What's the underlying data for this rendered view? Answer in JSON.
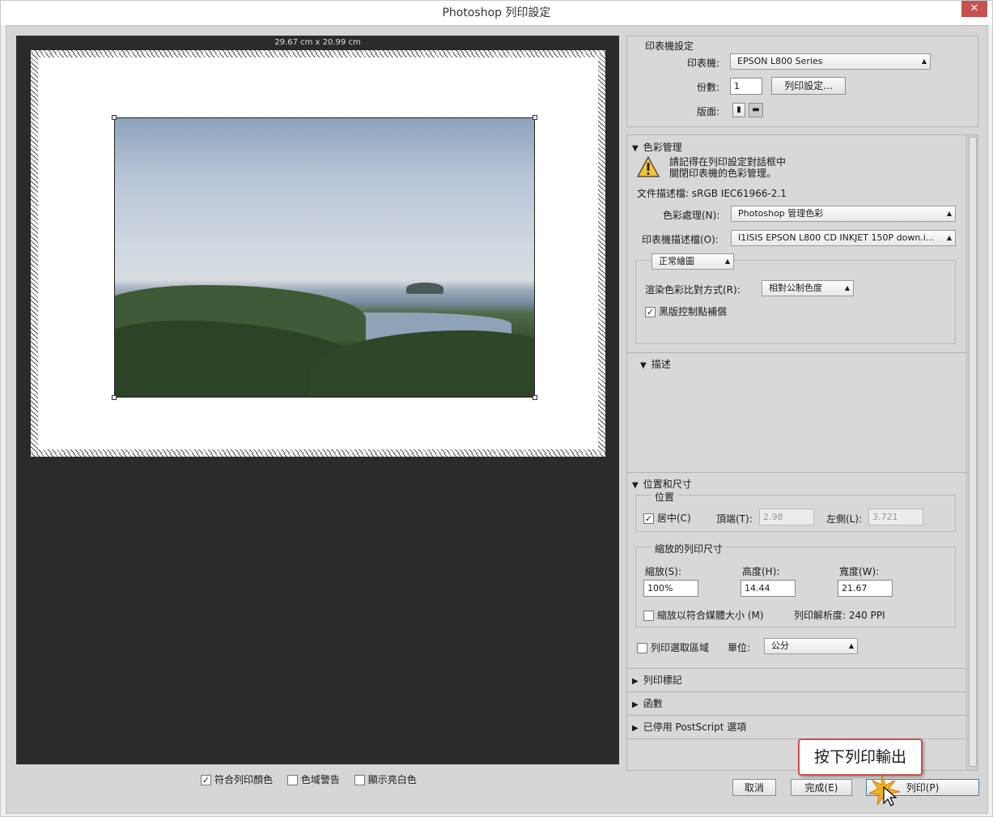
{
  "window": {
    "title": "Photoshop 列印設定",
    "close_glyph": "✕"
  },
  "preview": {
    "dimensions": "29.67 cm x 20.99 cm",
    "checks": [
      {
        "label": "符合列印顏色",
        "checked": true
      },
      {
        "label": "色域警告",
        "checked": false
      },
      {
        "label": "顯示亮白色",
        "checked": false
      }
    ]
  },
  "printer_setup": {
    "title": "印表機設定",
    "printer_label": "印表機:",
    "printer_value": "EPSON L800 Series",
    "copies_label": "份數:",
    "copies_value": "1",
    "print_settings_button": "列印設定...",
    "layout_label": "版面:"
  },
  "color_management": {
    "title": "色彩管理",
    "warning_line1": "請記得在列印設定對話框中",
    "warning_line2": "關閉印表機的色彩管理。",
    "doc_profile": "文件描述檔: sRGB IEC61966-2.1",
    "color_handling_label": "色彩處理(N):",
    "color_handling_value": "Photoshop 管理色彩",
    "printer_profile_label": "印表機描述檔(O):",
    "printer_profile_value": "I1ISIS EPSON L800 CD INKJET 150P down.i...",
    "normal_printing_value": "正常繪圖",
    "rendering_intent_label": "渲染色彩比對方式(R):",
    "rendering_intent_value": "相對公制色度",
    "bpc_label": "黑版控制點補償",
    "bpc_checked": true
  },
  "description": {
    "title": "描述"
  },
  "position_size": {
    "title": "位置和尺寸",
    "position_group": "位置",
    "center_label": "居中(C)",
    "center_checked": true,
    "top_label": "頂端(T):",
    "top_value": "2.98",
    "left_label": "左側(L):",
    "left_value": "3.721",
    "scaled_group": "縮放的列印尺寸",
    "scale_label": "縮放(S):",
    "scale_value": "100%",
    "height_label": "高度(H):",
    "height_value": "14.44",
    "width_label": "寬度(W):",
    "width_value": "21.67",
    "fit_media_label": "縮放以符合媒體大小 (M)",
    "resolution": "列印解析度: 240 PPI",
    "print_selection_label": "列印選取區域",
    "unit_label": "單位:",
    "unit_value": "公分"
  },
  "collapsed_sections": [
    "列印標記",
    "函數",
    "已停用 PostScript 選項"
  ],
  "callout": "按下列印輸出",
  "buttons": {
    "cancel": "取消",
    "done": "完成(E)",
    "print": "列印(P)"
  }
}
